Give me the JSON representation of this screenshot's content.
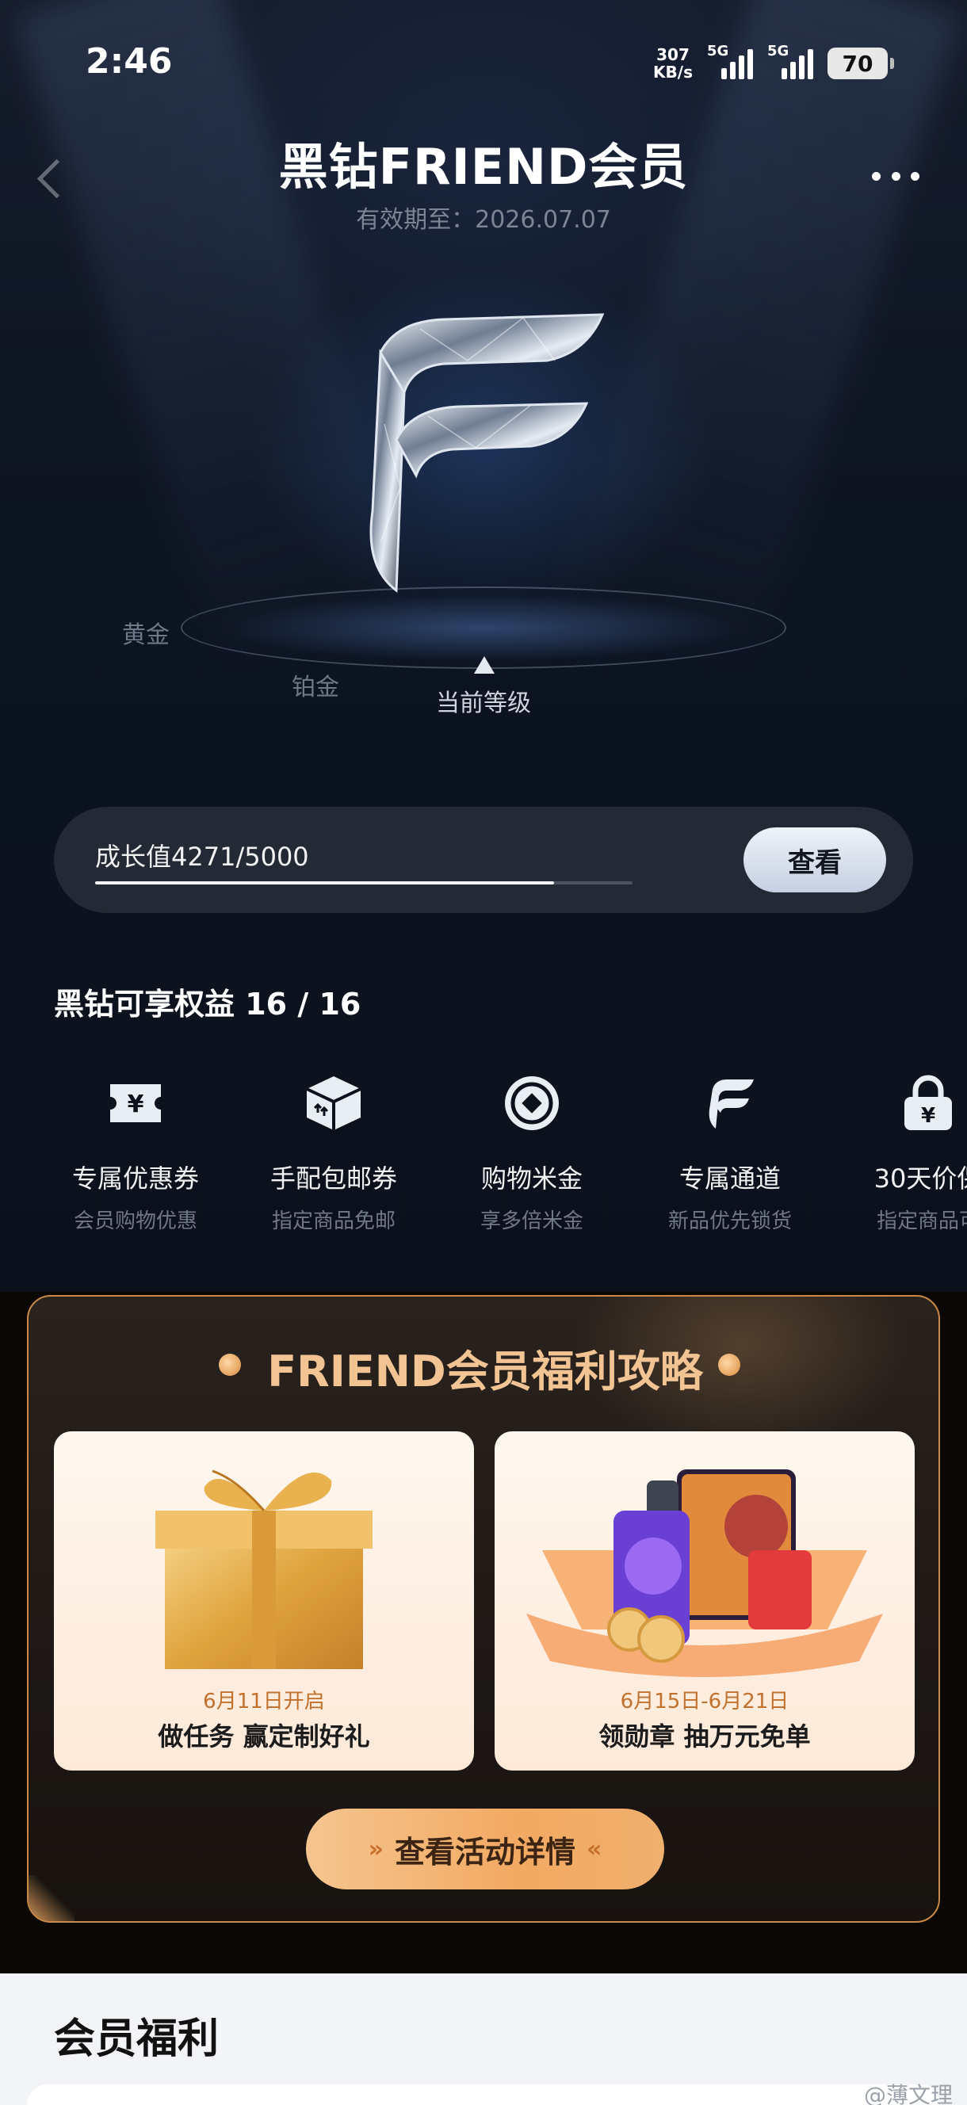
{
  "status_bar": {
    "time": "2:46",
    "net_speed_value": "307",
    "net_speed_unit": "KB/s",
    "signal_1": "5G",
    "signal_2": "5G",
    "battery": "70"
  },
  "header": {
    "title": "黑钻FRIEND会员",
    "validity": "有效期至：2026.07.07"
  },
  "levels": {
    "left_level": "黄金",
    "prev_level": "铂金",
    "current_label": "当前等级"
  },
  "growth": {
    "label": "成长值4271/5000",
    "current": 4271,
    "max": 5000,
    "view_button": "查看"
  },
  "benefits": {
    "title": "黑钻可享权益 16 / 16",
    "items": [
      {
        "name": "专属优惠券",
        "desc": "会员购物优惠",
        "icon": "coupon-icon"
      },
      {
        "name": "手配包邮券",
        "desc": "指定商品免邮",
        "icon": "package-icon"
      },
      {
        "name": "购物米金",
        "desc": "享多倍米金",
        "icon": "coin-icon"
      },
      {
        "name": "专属通道",
        "desc": "新品优先锁货",
        "icon": "friend-logo-icon"
      },
      {
        "name": "30天价保",
        "desc": "指定商品可",
        "icon": "price-lock-icon"
      }
    ]
  },
  "strategy": {
    "title": "FRIEND会员福利攻略",
    "cards": [
      {
        "date": "6月11日开启",
        "title": "做任务 赢定制好礼",
        "icon": "gift-box-icon"
      },
      {
        "date": "6月15日-6月21日",
        "title": "领勋章 抽万元免单",
        "icon": "devices-prize-icon"
      }
    ],
    "detail_button": "查看活动详情"
  },
  "member_welfare": {
    "title": "会员福利"
  },
  "watermark": "@薄文理",
  "colors": {
    "background": "#0c121d",
    "accent_gold": "#f2c494",
    "button_gold": "#f2a962"
  }
}
